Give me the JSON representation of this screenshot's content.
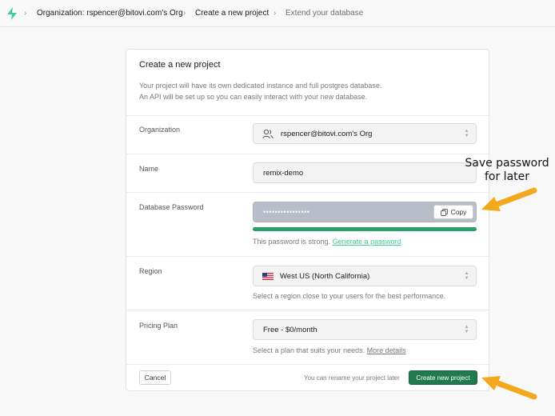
{
  "breadcrumb": {
    "org": "Organization: rspencer@bitovi.com's Org",
    "page": "Create a new project",
    "next": "Extend your database"
  },
  "card": {
    "title": "Create a new project",
    "desc_line1": "Your project will have its own dedicated instance and full postgres database.",
    "desc_line2": "An API will be set up so you can easily interact with your new database."
  },
  "form": {
    "organization": {
      "label": "Organization",
      "value": "rspencer@bitovi.com's Org",
      "icon": "users-icon"
    },
    "name": {
      "label": "Name",
      "value": "remix-demo"
    },
    "password": {
      "label": "Database Password",
      "value": "••••••••••••••••",
      "copy_label": "Copy",
      "strength": 1.0,
      "help_text": "This password is strong.",
      "help_link": "Generate a password",
      "strength_color": "#27a36a"
    },
    "region": {
      "label": "Region",
      "value": "West US (North California)",
      "help_text": "Select a region close to your users for the best performance."
    },
    "pricing": {
      "label": "Pricing Plan",
      "value": "Free - $0/month",
      "help_text": "Select a plan that suits your needs.",
      "help_link": "More details"
    }
  },
  "footer": {
    "cancel_label": "Cancel",
    "rename_note": "You can rename your project later",
    "create_label": "Create new project"
  },
  "annotation": {
    "line1": "Save password",
    "line2": "for later",
    "arrow_color": "#f4a81d"
  },
  "colors": {
    "accent": "#3ecf8e",
    "primary_button": "#1f7a52"
  }
}
